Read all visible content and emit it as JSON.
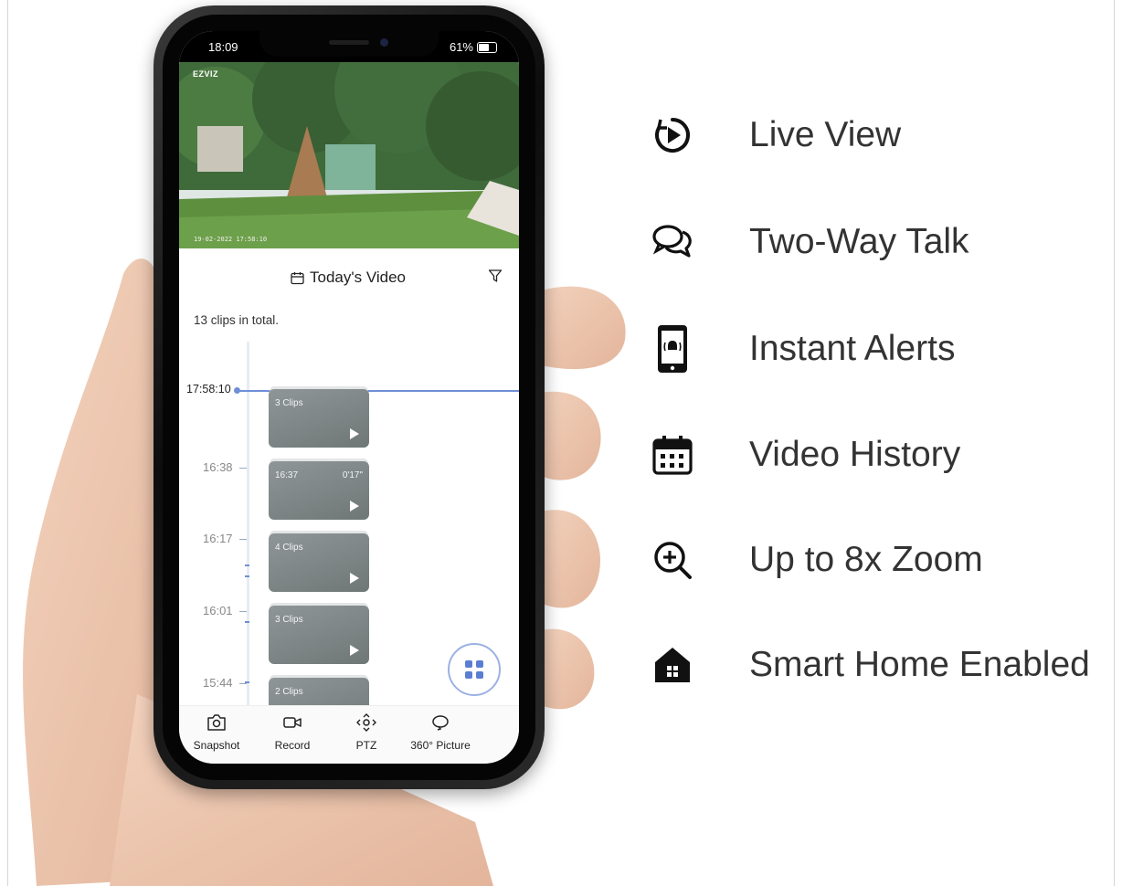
{
  "phone": {
    "status_time": "18:09",
    "battery": "61%",
    "brand": "EZVIZ",
    "timestamp": "19-02-2022 17:58:10",
    "header_title": "Today's Video",
    "clip_count": "13 clips in total.",
    "current_time": "17:58:10",
    "ticks": [
      "16:38",
      "16:17",
      "16:01",
      "15:44"
    ],
    "clips": [
      {
        "label": "3 Clips",
        "duration": ""
      },
      {
        "label": "16:37",
        "duration": "0'17\""
      },
      {
        "label": "4 Clips",
        "duration": ""
      },
      {
        "label": "3 Clips",
        "duration": ""
      },
      {
        "label": "2 Clips",
        "duration": ""
      }
    ],
    "toolbar": [
      "Snapshot",
      "Record",
      "PTZ",
      "360° Picture"
    ]
  },
  "features": [
    {
      "icon": "live-view-icon",
      "label": "Live View"
    },
    {
      "icon": "two-way-talk-icon",
      "label": "Two-Way Talk"
    },
    {
      "icon": "instant-alerts-icon",
      "label": "Instant Alerts"
    },
    {
      "icon": "video-history-icon",
      "label": "Video History"
    },
    {
      "icon": "zoom-icon",
      "label": "Up to 8x Zoom"
    },
    {
      "icon": "smart-home-icon",
      "label": "Smart Home Enabled"
    }
  ],
  "colors": {
    "accent": "#6f8fd6",
    "text": "#333333",
    "icon": "#111111"
  }
}
